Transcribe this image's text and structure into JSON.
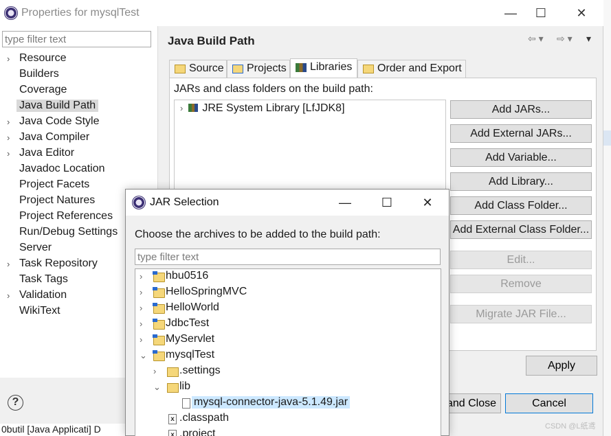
{
  "window": {
    "title": "Properties for mysqlTest",
    "minimize_glyph": "—",
    "maximize_glyph": "☐",
    "close_glyph": "✕"
  },
  "left_pane": {
    "filter_placeholder": "type filter text",
    "items": [
      {
        "label": "Resource",
        "expandable": true
      },
      {
        "label": "Builders",
        "expandable": false
      },
      {
        "label": "Coverage",
        "expandable": false
      },
      {
        "label": "Java Build Path",
        "expandable": false,
        "selected": true
      },
      {
        "label": "Java Code Style",
        "expandable": true
      },
      {
        "label": "Java Compiler",
        "expandable": true
      },
      {
        "label": "Java Editor",
        "expandable": true
      },
      {
        "label": "Javadoc Location",
        "expandable": false
      },
      {
        "label": "Project Facets",
        "expandable": false
      },
      {
        "label": "Project Natures",
        "expandable": false
      },
      {
        "label": "Project References",
        "expandable": false
      },
      {
        "label": "Run/Debug Settings",
        "expandable": false
      },
      {
        "label": "Server",
        "expandable": false
      },
      {
        "label": "Task Repository",
        "expandable": true
      },
      {
        "label": "Task Tags",
        "expandable": false
      },
      {
        "label": "Validation",
        "expandable": true
      },
      {
        "label": "WikiText",
        "expandable": false
      }
    ],
    "help_glyph": "?"
  },
  "right_pane": {
    "title": "Java Build Path",
    "tabs": [
      {
        "label": "Source"
      },
      {
        "label": "Projects"
      },
      {
        "label": "Libraries",
        "active": true
      },
      {
        "label": "Order and Export"
      }
    ],
    "jars_label": "JARs and class folders on the build path:",
    "library_entry": "JRE System Library [LfJDK8]",
    "buttons": {
      "add_jars": "Add JARs...",
      "add_external_jars": "Add External JARs...",
      "add_variable": "Add Variable...",
      "add_library": "Add Library...",
      "add_class_folder": "Add Class Folder...",
      "add_external_class_folder": "Add External Class Folder...",
      "edit": "Edit...",
      "remove": "Remove",
      "migrate_jar": "Migrate JAR File..."
    },
    "apply": "Apply",
    "apply_and_close": "and Close",
    "cancel": "Cancel"
  },
  "background": {
    "console_text": "0butil [Java Applicati] D"
  },
  "jar_dialog": {
    "title": "JAR Selection",
    "instruction": "Choose the archives to be added to the build path:",
    "filter_placeholder": "type filter text",
    "tree": [
      {
        "label": "hbu0516",
        "level": 0,
        "state": "collapsed",
        "icon": "project-icon"
      },
      {
        "label": "HelloSpringMVC",
        "level": 0,
        "state": "collapsed",
        "icon": "project-icon"
      },
      {
        "label": "HelloWorld",
        "level": 0,
        "state": "collapsed",
        "icon": "project-icon"
      },
      {
        "label": "JdbcTest",
        "level": 0,
        "state": "collapsed",
        "icon": "project-icon"
      },
      {
        "label": "MyServlet",
        "level": 0,
        "state": "collapsed",
        "icon": "project-icon"
      },
      {
        "label": "mysqlTest",
        "level": 0,
        "state": "expanded",
        "icon": "project-icon"
      },
      {
        "label": ".settings",
        "level": 1,
        "state": "collapsed",
        "icon": "folder-icon"
      },
      {
        "label": "lib",
        "level": 1,
        "state": "expanded",
        "icon": "folder-icon"
      },
      {
        "label": "mysql-connector-java-5.1.49.jar",
        "level": 2,
        "state": "leaf",
        "icon": "file-icon",
        "selected": true
      },
      {
        "label": ".classpath",
        "level": 1,
        "state": "leaf",
        "icon": "xml-file-icon"
      },
      {
        "label": ".project",
        "level": 1,
        "state": "leaf",
        "icon": "xml-file-icon"
      }
    ]
  },
  "watermark": "CSDN @L纸鸢"
}
